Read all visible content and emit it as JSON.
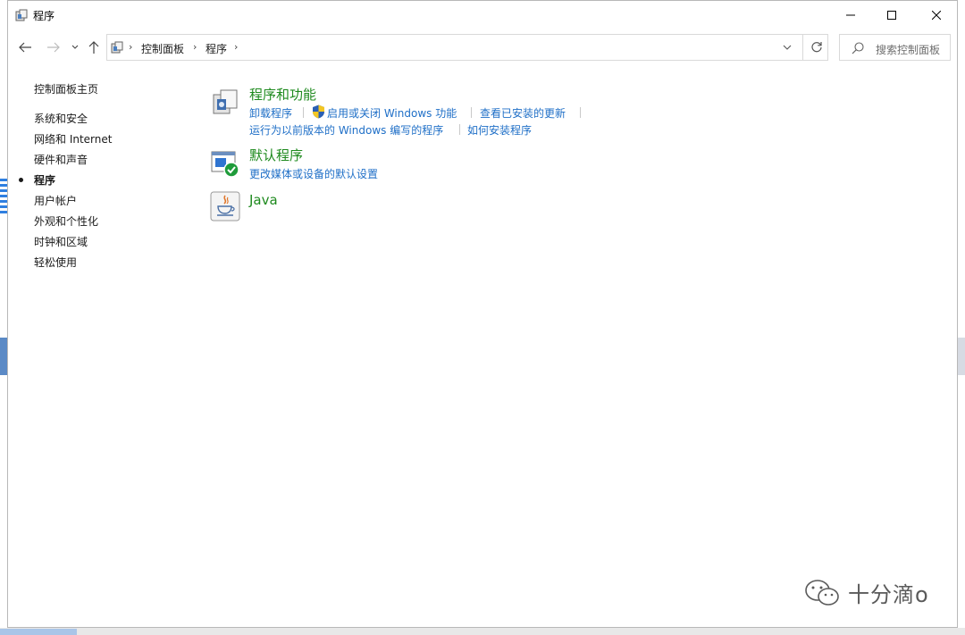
{
  "window": {
    "title": "程序",
    "minimize_icon": "minimize-icon",
    "maximize_icon": "maximize-icon",
    "close_icon": "close-icon"
  },
  "navigation": {
    "address_icon": "control-panel-icon",
    "breadcrumb": [
      "控制面板",
      "程序"
    ],
    "search_placeholder": "搜索控制面板"
  },
  "sidebar": {
    "home": "控制面板主页",
    "items": [
      {
        "label": "系统和安全",
        "active": false
      },
      {
        "label": "网络和 Internet",
        "active": false
      },
      {
        "label": "硬件和声音",
        "active": false
      },
      {
        "label": "程序",
        "active": true
      },
      {
        "label": "用户帐户",
        "active": false
      },
      {
        "label": "外观和个性化",
        "active": false
      },
      {
        "label": "时钟和区域",
        "active": false
      },
      {
        "label": "轻松使用",
        "active": false
      }
    ]
  },
  "categories": {
    "programs_features": {
      "title": "程序和功能",
      "icon": "programs-features-icon",
      "links": [
        "卸载程序",
        "启用或关闭 Windows 功能",
        "查看已安装的更新",
        "运行为以前版本的 Windows 编写的程序",
        "如何安装程序"
      ]
    },
    "default_programs": {
      "title": "默认程序",
      "icon": "default-programs-icon",
      "links": [
        "更改媒体或设备的默认设置"
      ]
    },
    "java": {
      "title": "Java",
      "icon": "java-icon"
    }
  },
  "watermark": {
    "text": "十分滴o"
  },
  "colors": {
    "category_title": "#1e8a1e",
    "link": "#1f6fc7",
    "text": "#1a1a1a"
  }
}
